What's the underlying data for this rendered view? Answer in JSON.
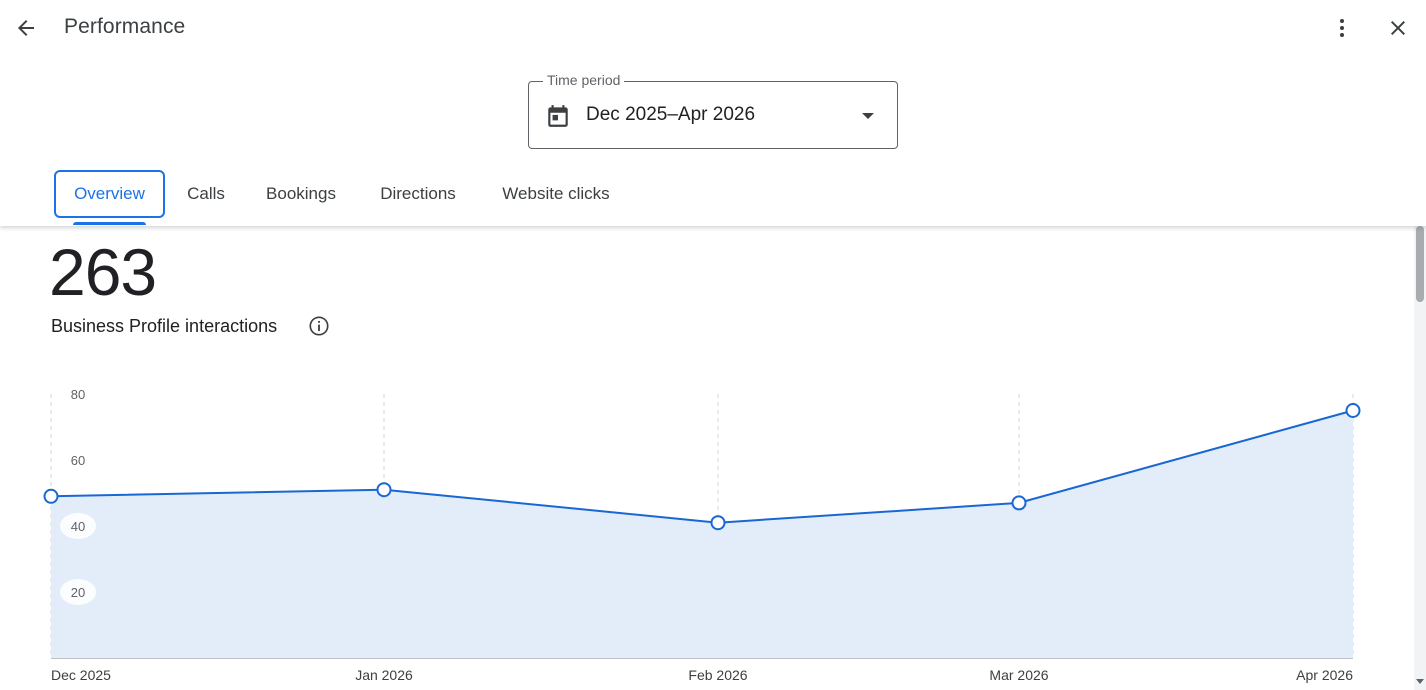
{
  "header": {
    "title": "Performance",
    "back_icon": "arrow-back-icon",
    "more_icon": "more-vert-icon",
    "close_icon": "close-icon"
  },
  "time_period": {
    "label": "Time period",
    "value": "Dec 2025–Apr 2026",
    "icon": "calendar-icon"
  },
  "tabs": [
    {
      "label": "Overview",
      "active": true
    },
    {
      "label": "Calls",
      "active": false
    },
    {
      "label": "Bookings",
      "active": false
    },
    {
      "label": "Directions",
      "active": false
    },
    {
      "label": "Website clicks",
      "active": false
    }
  ],
  "summary": {
    "total": "263",
    "label": "Business Profile interactions",
    "info_icon": "info-icon"
  },
  "colors": {
    "accent": "#1a73e8",
    "line": "#1967d2",
    "area": "#e3edfa"
  },
  "chart_data": {
    "type": "area",
    "x": [
      "Dec 2025",
      "Jan 2026",
      "Feb 2026",
      "Mar 2026",
      "Apr 2026"
    ],
    "series": [
      {
        "values": [
          49,
          51,
          41,
          47,
          75
        ]
      }
    ],
    "yticks": [
      20,
      40,
      60,
      80
    ],
    "ylim": [
      0,
      80
    ],
    "grid": "vertical-dashed"
  }
}
